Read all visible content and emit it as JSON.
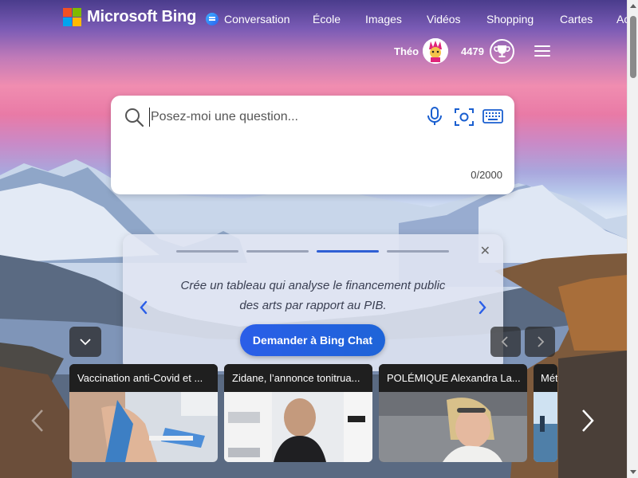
{
  "brand": {
    "name": "Microsoft Bing"
  },
  "nav": {
    "items": [
      {
        "label": "Conversation"
      },
      {
        "label": "École"
      },
      {
        "label": "Images"
      },
      {
        "label": "Vidéos"
      },
      {
        "label": "Shopping"
      },
      {
        "label": "Cartes"
      },
      {
        "label": "Ac"
      }
    ]
  },
  "user": {
    "name": "Théo",
    "points": "4479"
  },
  "search": {
    "placeholder": "Posez-moi une question...",
    "value": "",
    "char_count": "0/2000"
  },
  "suggestion": {
    "text_line1": "Crée un tableau qui analyse le financement public",
    "text_line2": "des arts par rapport au PIB.",
    "button": "Demander à Bing Chat",
    "steps": 4,
    "active_step": 3
  },
  "news": [
    {
      "title": "Vaccination anti-Covid et ..."
    },
    {
      "title": "Zidane, l’annonce tonitrua..."
    },
    {
      "title": "POLÉMIQUE Alexandra La..."
    },
    {
      "title": "Mét"
    }
  ],
  "colors": {
    "accent": "#2f5fd4",
    "button": "#2a5ee8"
  }
}
